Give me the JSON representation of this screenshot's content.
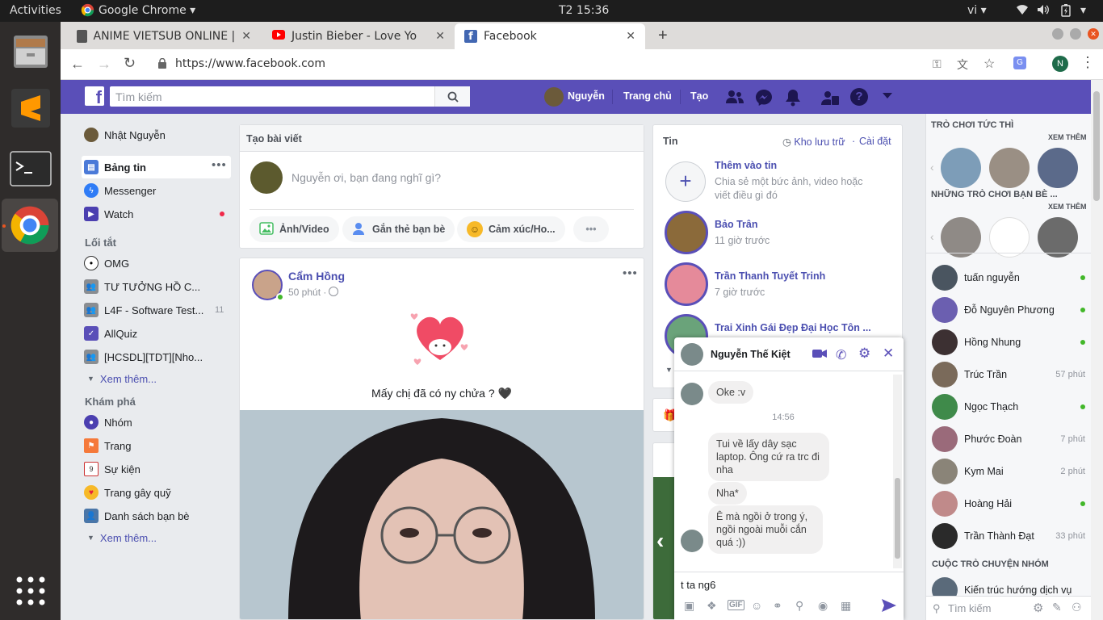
{
  "system": {
    "activities": "Activities",
    "app_menu": "Google Chrome",
    "clock": "T2 15:36",
    "lang": "vi"
  },
  "tabs": [
    {
      "label": "ANIME VIETSUB ONLINE |",
      "active": false
    },
    {
      "label": "Justin Bieber - Love Yo",
      "active": false
    },
    {
      "label": "Facebook",
      "active": true
    }
  ],
  "address": {
    "url": "https://www.facebook.com",
    "profile_initial": "N"
  },
  "fb": {
    "search_placeholder": "Tìm kiếm",
    "user_short": "Nguyễn",
    "nav_home": "Trang chủ",
    "nav_create": "Tạo"
  },
  "left": {
    "profile": "Nhật Nguyễn",
    "main": [
      "Bảng tin",
      "Messenger",
      "Watch"
    ],
    "shortcuts_title": "Lối tắt",
    "shortcuts": [
      {
        "label": "OMG",
        "count": ""
      },
      {
        "label": "TƯ TƯỞNG HỒ C...",
        "count": ""
      },
      {
        "label": "L4F - Software Test...",
        "count": "11"
      },
      {
        "label": "AllQuiz",
        "count": ""
      },
      {
        "label": "[HCSDL][TDT][Nho...",
        "count": ""
      }
    ],
    "see_more": "Xem thêm...",
    "explore_title": "Khám phá",
    "explore": [
      "Nhóm",
      "Trang",
      "Sự kiện",
      "Trang gây quỹ",
      "Danh sách bạn bè"
    ],
    "see_more2": "Xem thêm..."
  },
  "composer": {
    "header": "Tạo bài viết",
    "placeholder": "Nguyễn ơi, bạn đang nghĩ gì?",
    "photo": "Ảnh/Video",
    "tag": "Gắn thẻ bạn bè",
    "feeling": "Cảm xúc/Ho..."
  },
  "post": {
    "author": "Cẩm Hồng",
    "time": "50 phút ·",
    "caption": "Mấy chị đã có ny chửa ? 🖤"
  },
  "stories": {
    "title": "Tin",
    "archive": "Kho lưu trữ",
    "settings": "Cài đặt",
    "add_title": "Thêm vào tin",
    "add_desc": "Chia sẻ một bức ảnh, video hoặc viết điều gì đó",
    "items": [
      {
        "name": "Bảo Trân",
        "time": "11 giờ trước"
      },
      {
        "name": "Trần Thanh Tuyết Trinh",
        "time": "7 giờ trước"
      },
      {
        "name": "Trai Xinh Gái Đẹp Đại Học Tôn ...",
        "time": ""
      }
    ]
  },
  "right": {
    "games_title": "TRÒ CHƠI TỨC THÌ",
    "see_all": "XEM THÊM",
    "friends_games_title": "NHỮNG TRÒ CHƠI BẠN BÈ ...",
    "see_all2": "XEM THÊM",
    "contacts": [
      {
        "name": "tuấn nguyễn",
        "status": "online",
        "time": ""
      },
      {
        "name": "Đỗ Nguyên Phương",
        "status": "online",
        "time": ""
      },
      {
        "name": "Hồng Nhung",
        "status": "online",
        "time": ""
      },
      {
        "name": "Trúc Trần",
        "status": "idle",
        "time": "57 phút"
      },
      {
        "name": "Ngọc Thạch",
        "status": "online",
        "time": ""
      },
      {
        "name": "Phước Đoàn",
        "status": "idle",
        "time": "7 phút"
      },
      {
        "name": "Kym Mai",
        "status": "idle",
        "time": "2 phút"
      },
      {
        "name": "Hoàng Hải",
        "status": "online",
        "time": ""
      },
      {
        "name": "Trần Thành Đạt",
        "status": "idle",
        "time": "33 phút"
      }
    ],
    "group_title": "CUỘC TRÒ CHUYỆN NHÓM",
    "group_item": "Kiến trúc hướng dịch vụ",
    "search_placeholder": "Tìm kiếm"
  },
  "chat": {
    "name": "Nguyễn Thế Kiệt",
    "messages": [
      {
        "from": "them",
        "text": "Oke :v"
      },
      {
        "from": "time",
        "text": "14:56"
      },
      {
        "from": "them",
        "text": "Tui về lấy dây sạc laptop. Ông cứ ra trc đi nha"
      },
      {
        "from": "them",
        "text": "Nha*"
      },
      {
        "from": "them",
        "text": "Ê mà ngồi ở trong ý, ngồi ngoài muỗi cắn quá :))"
      }
    ],
    "input_value": "t ta ng6"
  },
  "colors": {
    "fb_header": "#5a4fb8",
    "accent": "#4b4fb0",
    "online": "#42b72a",
    "send": "#5a4fb8"
  }
}
